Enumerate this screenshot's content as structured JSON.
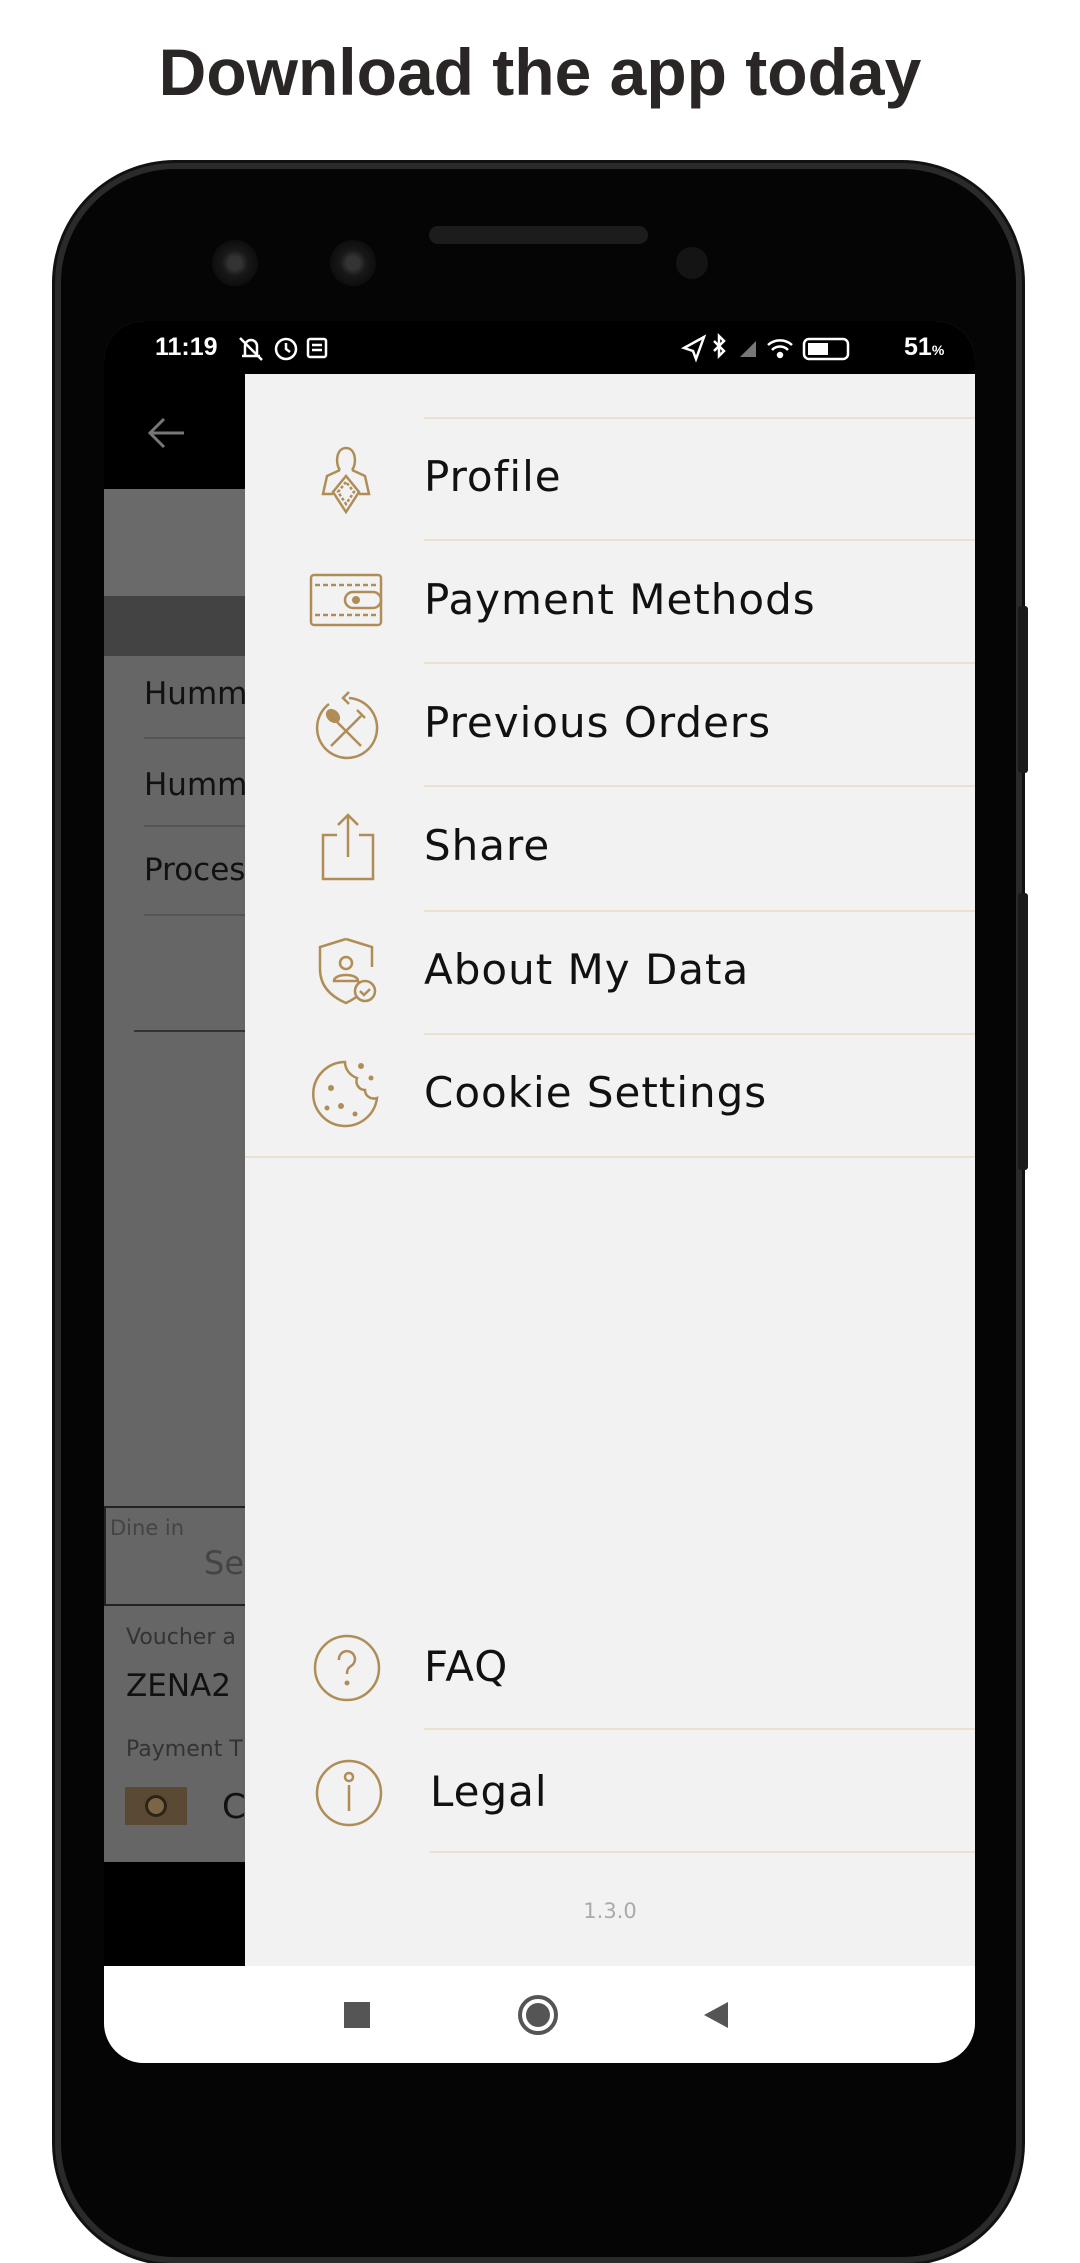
{
  "headline": "Download the app today",
  "status_bar": {
    "time": "11:19",
    "battery": "51",
    "battery_unit": "%",
    "icons_left": [
      "mute-icon",
      "alarm-icon",
      "notification-icon"
    ],
    "icons_right": [
      "location-icon",
      "bluetooth-icon",
      "signal-icon",
      "wifi-icon",
      "battery-icon"
    ]
  },
  "background_screen": {
    "items": [
      "Humm",
      "Humm",
      "Proces"
    ],
    "dine_in_label": "Dine in",
    "dine_in_value": "Se",
    "voucher_label": "Voucher a",
    "voucher_value": "ZENA2",
    "payment_label": "Payment T",
    "payment_value": "C"
  },
  "drawer": {
    "menu": [
      {
        "label": "Profile",
        "icon": "profile-icon"
      },
      {
        "label": "Payment Methods",
        "icon": "wallet-icon"
      },
      {
        "label": "Previous Orders",
        "icon": "previous-orders-icon"
      },
      {
        "label": "Share",
        "icon": "share-icon"
      },
      {
        "label": "About My Data",
        "icon": "data-shield-icon"
      },
      {
        "label": "Cookie Settings",
        "icon": "cookie-icon"
      }
    ],
    "footer_menu": [
      {
        "label": "FAQ",
        "icon": "question-icon"
      },
      {
        "label": "Legal",
        "icon": "info-icon"
      }
    ],
    "version": "1.3.0"
  },
  "colors": {
    "accent": "#b08d57",
    "drawer_bg": "#f2f2f2",
    "separator": "#ede0d0"
  }
}
